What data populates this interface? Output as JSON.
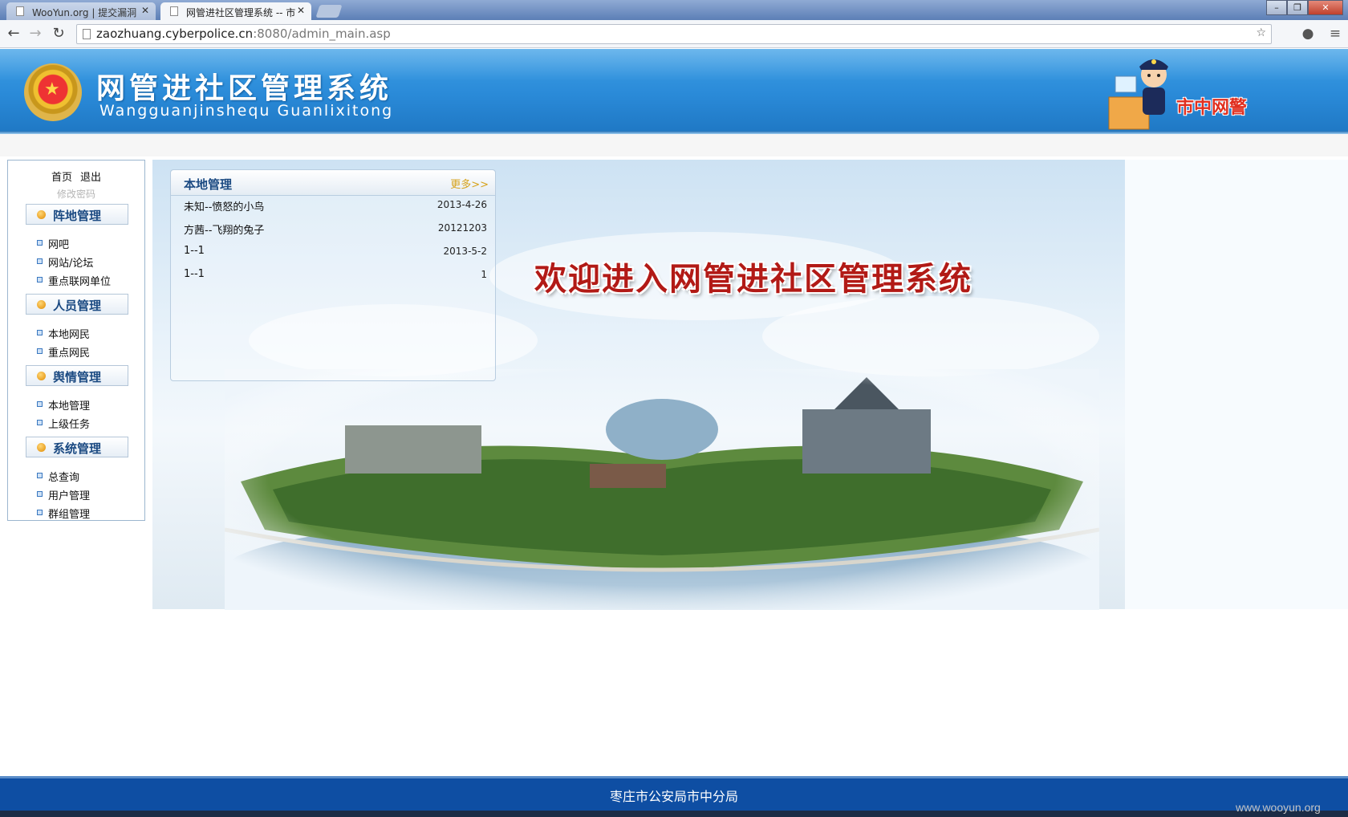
{
  "browser": {
    "tabs": [
      {
        "label": "WooYun.org | 提交漏洞"
      },
      {
        "label": "网管进社区管理系统 -- 市"
      }
    ],
    "url_host": "zaozhuang.cyberpolice.cn",
    "url_rest": ":8080/admin_main.asp"
  },
  "header": {
    "title": "网管进社区管理系统",
    "pinyin": "Wangguanjinshequ  Guanlixitong",
    "brand": "市中网警"
  },
  "sidebar": {
    "home": "首页",
    "logout": "退出",
    "change_password": "修改密码",
    "sections": [
      {
        "title": "阵地管理",
        "items": [
          "网吧",
          "网站/论坛",
          "重点联网单位"
        ]
      },
      {
        "title": "人员管理",
        "items": [
          "本地网民",
          "重点网民"
        ]
      },
      {
        "title": "舆情管理",
        "items": [
          "本地管理",
          "上级任务"
        ]
      },
      {
        "title": "系统管理",
        "items": [
          "总查询",
          "用户管理",
          "群组管理"
        ]
      }
    ]
  },
  "news": {
    "title": "本地管理",
    "more": "更多>>",
    "rows": [
      {
        "title": "未知--愤怒的小鸟",
        "date": "2013-4-26"
      },
      {
        "title": "方茜--飞翔的兔子",
        "date": "20121203"
      },
      {
        "title": "1--1",
        "date": "2013-5-2"
      },
      {
        "title": "1--1",
        "date": "1"
      }
    ]
  },
  "welcome": "欢迎进入网管进社区管理系统",
  "footer": "枣庄市公安局市中分局",
  "watermark": "www.wooyun.org"
}
